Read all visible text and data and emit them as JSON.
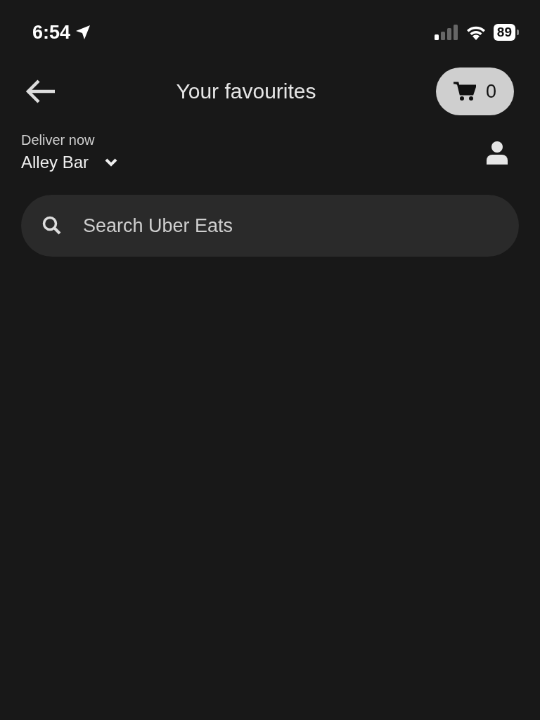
{
  "status_bar": {
    "time": "6:54",
    "battery": "89"
  },
  "header": {
    "title": "Your favourites",
    "cart_count": "0"
  },
  "delivery": {
    "label": "Deliver now",
    "location": "Alley Bar"
  },
  "search": {
    "placeholder": "Search Uber Eats"
  }
}
